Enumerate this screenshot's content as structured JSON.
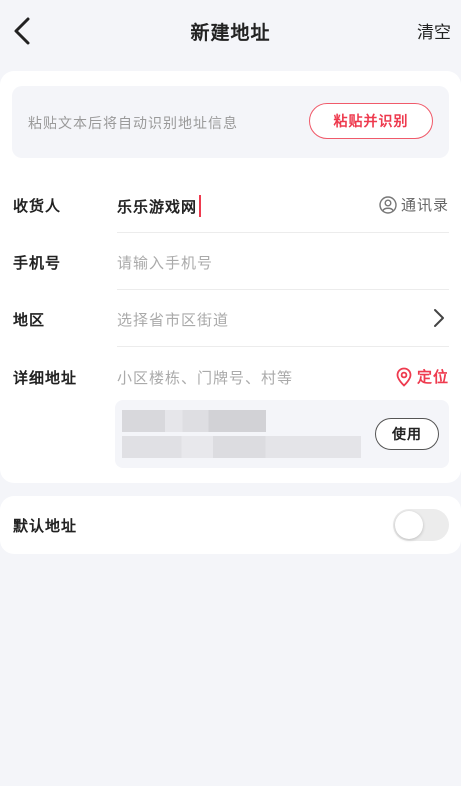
{
  "header": {
    "title": "新建地址",
    "clear_label": "清空"
  },
  "paste": {
    "hint": "粘贴文本后将自动识别地址信息",
    "button_label": "粘贴并识别"
  },
  "form": {
    "recipient": {
      "label": "收货人",
      "value": "乐乐游戏网",
      "contacts_label": "通讯录"
    },
    "phone": {
      "label": "手机号",
      "placeholder": "请输入手机号"
    },
    "region": {
      "label": "地区",
      "placeholder": "选择省市区街道"
    },
    "detail": {
      "label": "详细地址",
      "placeholder": "小区楼栋、门牌号、村等",
      "locate_label": "定位"
    },
    "suggestion": {
      "use_label": "使用"
    }
  },
  "default_address": {
    "label": "默认地址",
    "enabled": false
  },
  "colors": {
    "accent": "#ee3a4e",
    "background": "#f4f5f9"
  },
  "icons": [
    "back-arrow-icon",
    "contacts-icon",
    "chevron-right-icon",
    "location-pin-icon"
  ]
}
